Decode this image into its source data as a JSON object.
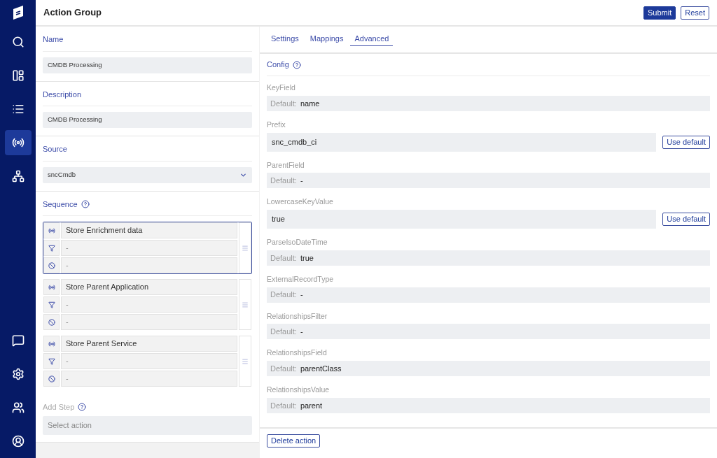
{
  "sidebar": {
    "items": [
      {
        "selected": false
      },
      {
        "selected": false
      },
      {
        "selected": false
      },
      {
        "selected": true
      },
      {
        "selected": false
      }
    ],
    "bottom_items": [
      {
        "selected": false
      },
      {
        "selected": false
      },
      {
        "selected": false
      },
      {
        "selected": false
      }
    ]
  },
  "header": {
    "title": "Action Group",
    "buttons": [
      {
        "label": "Submit",
        "kind": "primary"
      },
      {
        "label": "Reset",
        "kind": "outline"
      }
    ]
  },
  "form": {
    "name": {
      "label": "Name",
      "value": "CMDB Processing"
    },
    "description": {
      "label": "Description",
      "value": "CMDB Processing"
    },
    "source": {
      "label": "Source",
      "value": "sncCmdb"
    },
    "sequence": {
      "label": "Sequence",
      "steps": [
        {
          "name": "Store Enrichment data",
          "filter": "-",
          "exclusion": "-",
          "selected": true
        },
        {
          "name": "Store Parent Application",
          "filter": "-",
          "exclusion": "-",
          "selected": false
        },
        {
          "name": "Store Parent Service",
          "filter": "-",
          "exclusion": "-",
          "selected": false
        }
      ]
    },
    "add_step": {
      "label": "Add Step",
      "placeholder": "Select action"
    }
  },
  "tabs": [
    {
      "label": "Settings",
      "selected": false
    },
    {
      "label": "Mappings",
      "selected": false
    },
    {
      "label": "Advanced",
      "selected": true
    }
  ],
  "config": {
    "title": "Config",
    "fields": [
      {
        "label": "KeyField",
        "kind": "default",
        "prefix": "Default:",
        "value": "name"
      },
      {
        "label": "Prefix",
        "kind": "custom",
        "value": "snc_cmdb_ci",
        "button": "Use default"
      },
      {
        "label": "ParentField",
        "kind": "default",
        "prefix": "Default:",
        "value": "-"
      },
      {
        "label": "LowercaseKeyValue",
        "kind": "custom",
        "value": "true",
        "button": "Use default"
      },
      {
        "label": "ParseIsoDateTime",
        "kind": "default",
        "prefix": "Default:",
        "value": "true"
      },
      {
        "label": "ExternalRecordType",
        "kind": "default",
        "prefix": "Default:",
        "value": "-"
      },
      {
        "label": "RelationshipsFilter",
        "kind": "default",
        "prefix": "Default:",
        "value": "-"
      },
      {
        "label": "RelationshipsField",
        "kind": "default",
        "prefix": "Default:",
        "value": "parentClass"
      },
      {
        "label": "RelationshipsValue",
        "kind": "default",
        "prefix": "Default:",
        "value": "parent"
      }
    ]
  },
  "footer": {
    "button": "Delete action"
  }
}
